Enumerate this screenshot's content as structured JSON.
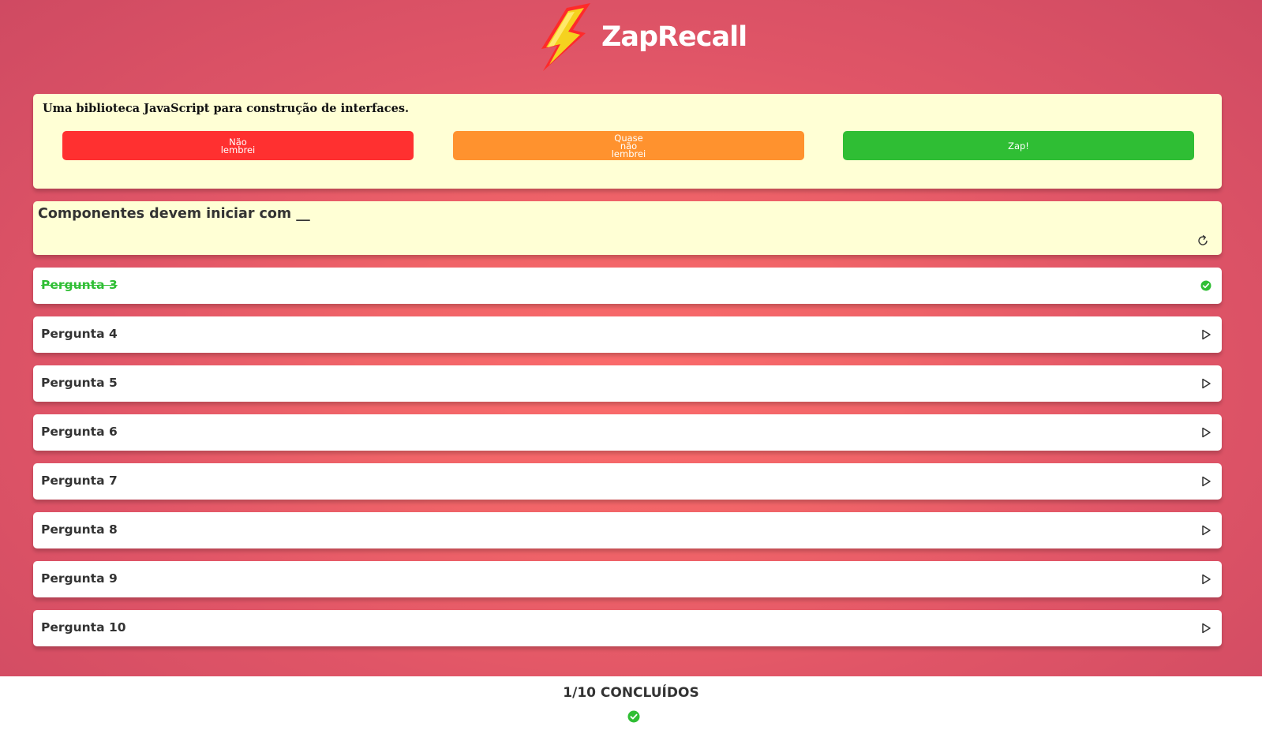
{
  "app": {
    "title": "ZapRecall"
  },
  "answer_card": {
    "text": "Uma biblioteca JavaScript para construção de interfaces.",
    "buttons": [
      {
        "label": "Não\nlembrei",
        "color": "#ff3030"
      },
      {
        "label": "Quase\nnão\nlembrei",
        "color": "#ff922e"
      },
      {
        "label": "Zap!",
        "color": "#2fbe34"
      }
    ]
  },
  "question_card": {
    "text": "Componentes devem iniciar com __",
    "icon": "turn-icon"
  },
  "questions": [
    {
      "label": "Pergunta 3",
      "status": "done",
      "icon": "check-circle-icon"
    },
    {
      "label": "Pergunta 4",
      "status": "closed",
      "icon": "play-icon"
    },
    {
      "label": "Pergunta 5",
      "status": "closed",
      "icon": "play-icon"
    },
    {
      "label": "Pergunta 6",
      "status": "closed",
      "icon": "play-icon"
    },
    {
      "label": "Pergunta 7",
      "status": "closed",
      "icon": "play-icon"
    },
    {
      "label": "Pergunta 8",
      "status": "closed",
      "icon": "play-icon"
    },
    {
      "label": "Pergunta 9",
      "status": "closed",
      "icon": "play-icon"
    },
    {
      "label": "Pergunta 10",
      "status": "closed",
      "icon": "play-icon"
    }
  ],
  "footer": {
    "progress": "1/10 CONCLUÍDOS",
    "icons": [
      "check-circle-icon"
    ]
  },
  "colors": {
    "background": "#f06468",
    "card": "#ffffd5",
    "red": "#ff3030",
    "orange": "#ff922e",
    "green": "#2fbe34"
  }
}
